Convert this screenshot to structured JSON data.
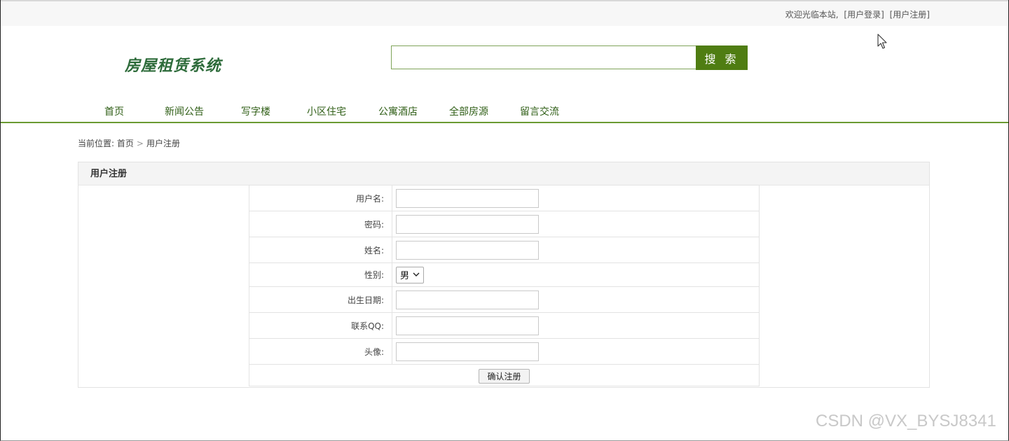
{
  "topbar": {
    "welcome": "欢迎光临本站,",
    "login_link": "[用户登录]",
    "register_link": "[用户注册]"
  },
  "header": {
    "logo": "房屋租赁系统",
    "search": {
      "value": "",
      "placeholder": "",
      "button_label": "搜 索"
    }
  },
  "nav": {
    "items": [
      "首页",
      "新闻公告",
      "写字楼",
      "小区住宅",
      "公寓酒店",
      "全部房源",
      "留言交流"
    ]
  },
  "breadcrumb": {
    "prefix": "当前位置:",
    "home": "首页",
    "separator": ">",
    "current": "用户注册"
  },
  "form": {
    "title": "用户注册",
    "fields": {
      "username": {
        "label": "用户名:",
        "value": ""
      },
      "password": {
        "label": "密码:",
        "value": ""
      },
      "name": {
        "label": "姓名:",
        "value": ""
      },
      "gender": {
        "label": "性别:",
        "selected": "男"
      },
      "birthdate": {
        "label": "出生日期:",
        "value": ""
      },
      "qq": {
        "label": "联系QQ:",
        "value": ""
      },
      "avatar": {
        "label": "头像:",
        "value": ""
      }
    },
    "submit_label": "确认注册"
  },
  "watermark": "CSDN @VX_BYSJ8341",
  "colors": {
    "accent_green": "#4f7d12",
    "logo_green": "#2d6b3a",
    "nav_text": "#2f5e16",
    "nav_border": "#6a9a32"
  }
}
